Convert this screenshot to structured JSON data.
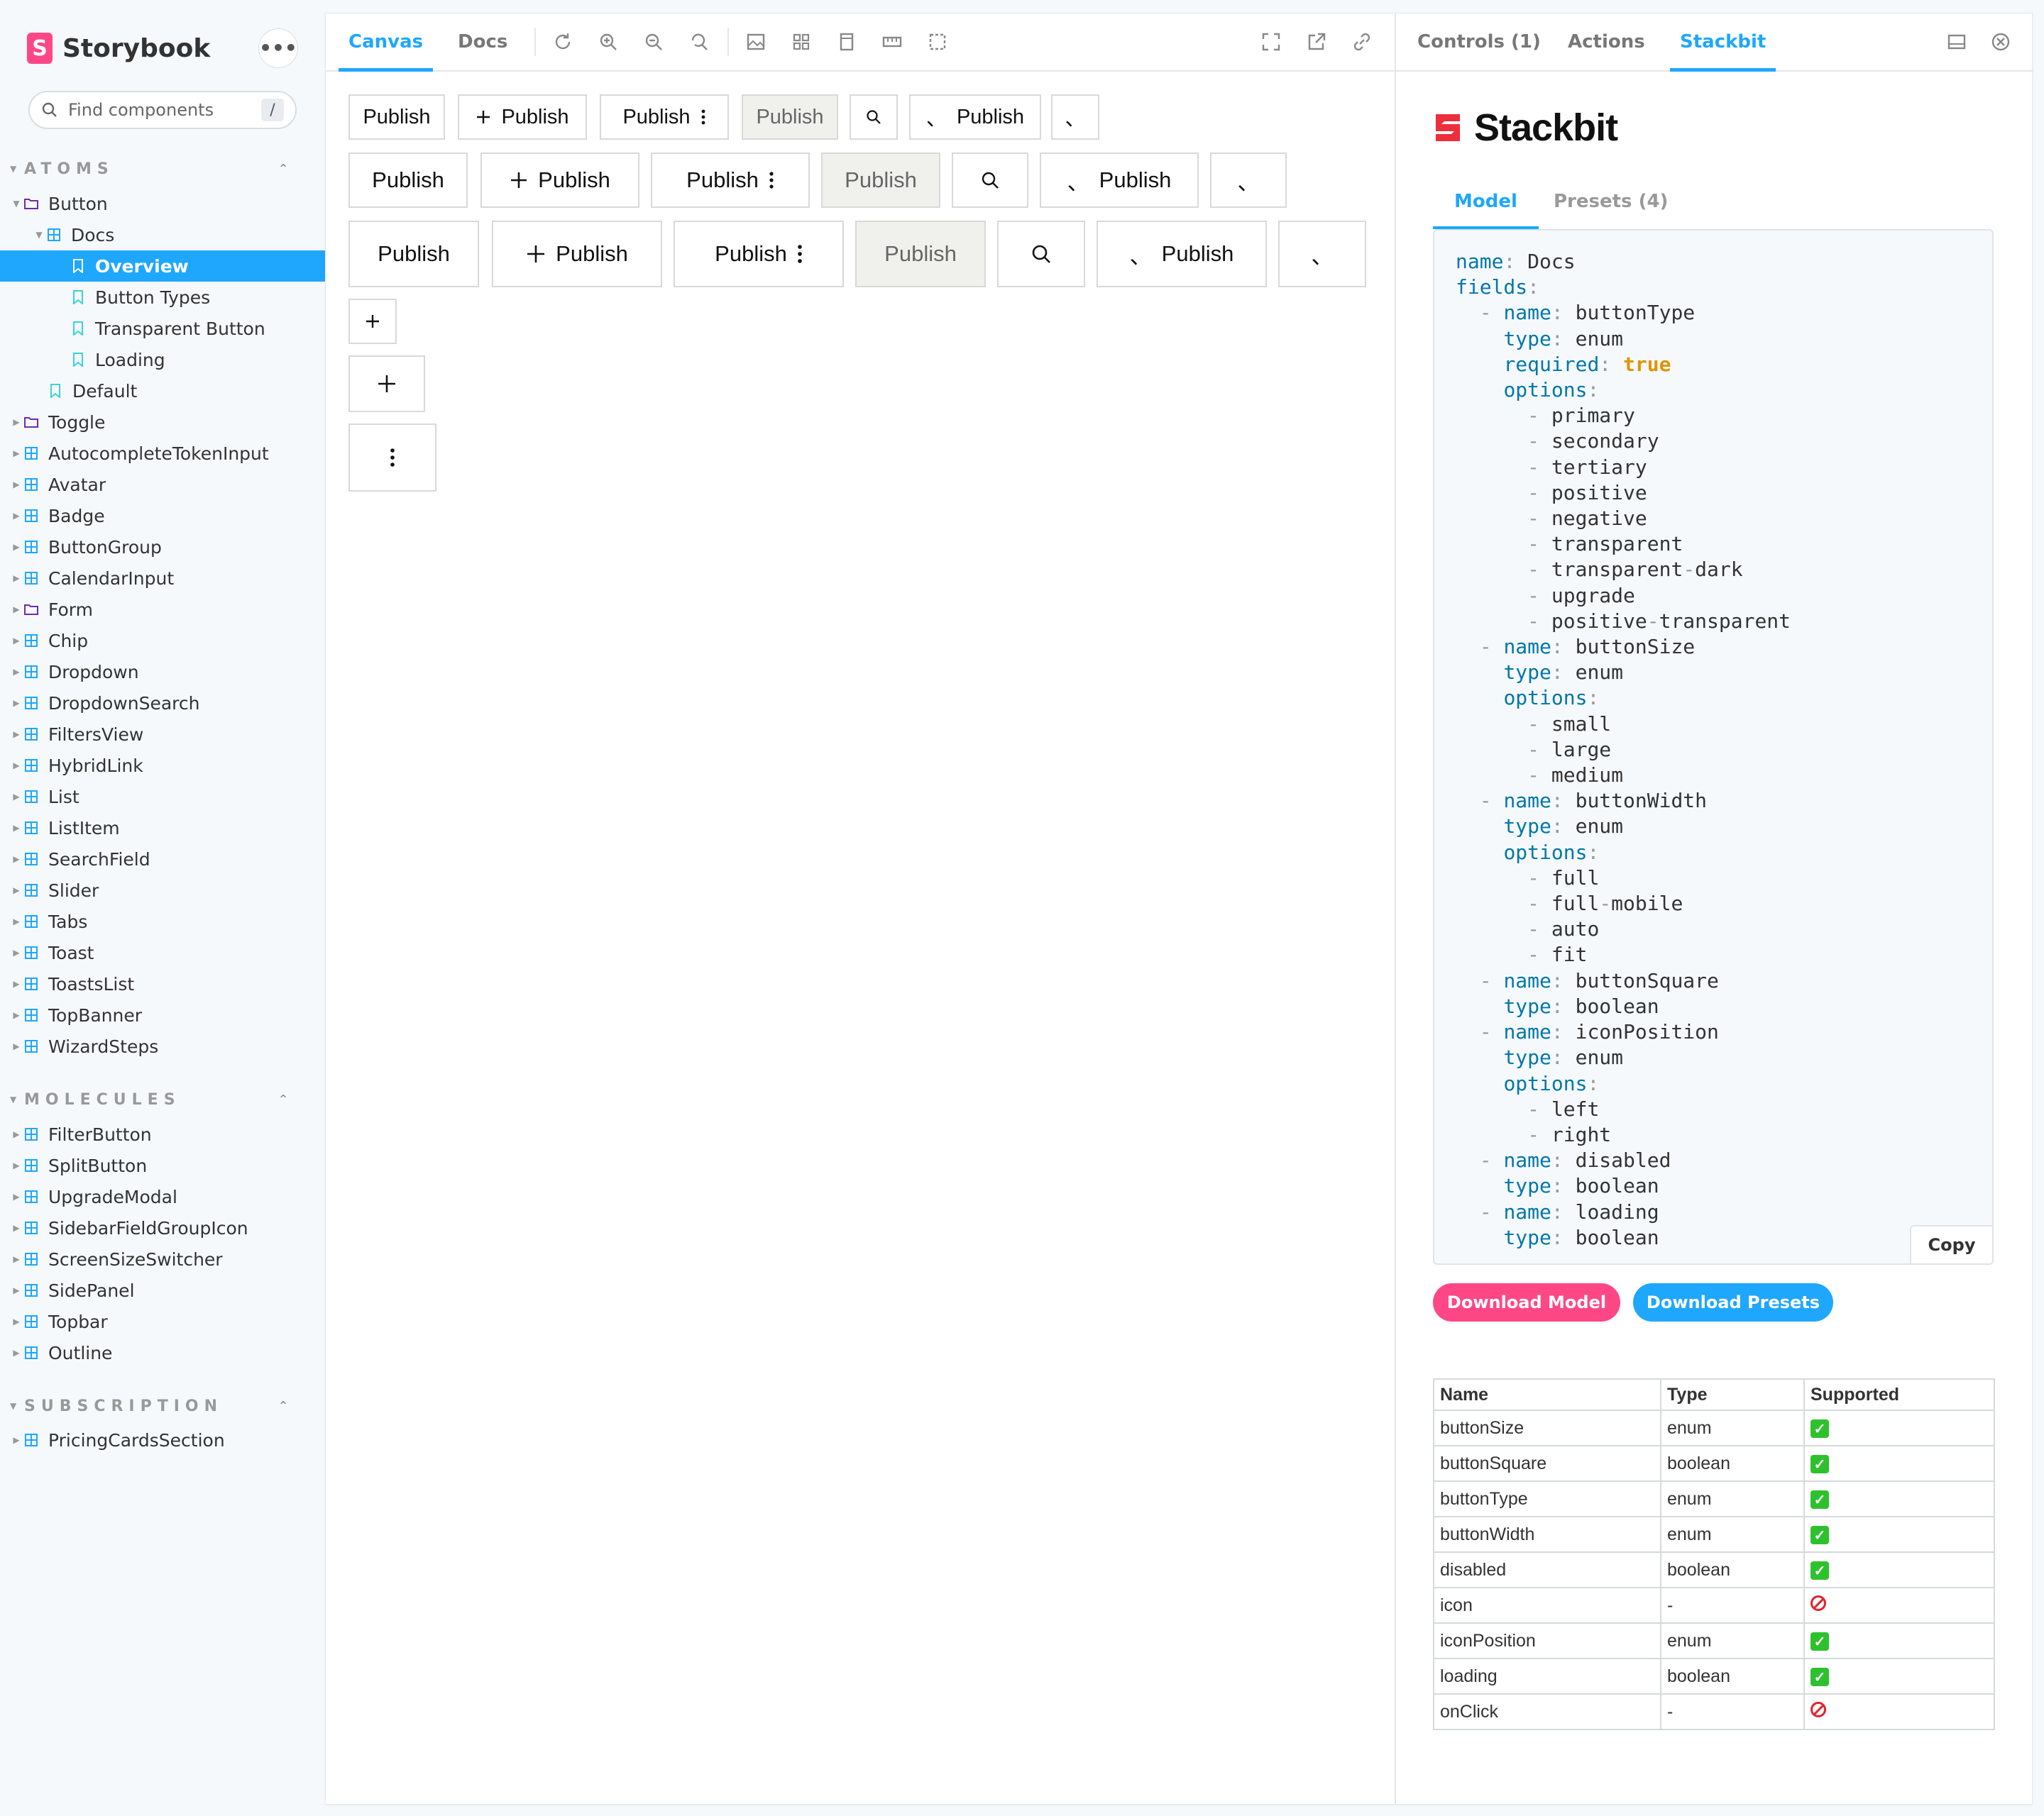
{
  "sidebar": {
    "brand": "Storybook",
    "search_placeholder": "Find components",
    "search_shortcut": "/",
    "sections": [
      {
        "title": "ATOMS"
      },
      {
        "title": "MOLECULES"
      },
      {
        "title": "SUBSCRIPTION"
      }
    ],
    "atoms": {
      "button": "Button",
      "docs": "Docs",
      "overview": "Overview",
      "button_types": "Button Types",
      "transparent_button": "Transparent Button",
      "loading": "Loading",
      "default": "Default",
      "items": [
        "Toggle",
        "AutocompleteTokenInput",
        "Avatar",
        "Badge",
        "ButtonGroup",
        "CalendarInput",
        "Form",
        "Chip",
        "Dropdown",
        "DropdownSearch",
        "FiltersView",
        "HybridLink",
        "List",
        "ListItem",
        "SearchField",
        "Slider",
        "Tabs",
        "Toast",
        "ToastsList",
        "TopBanner",
        "WizardSteps"
      ]
    },
    "molecules": [
      "FilterButton",
      "SplitButton",
      "UpgradeModal",
      "SidebarFieldGroupIcon",
      "ScreenSizeSwitcher",
      "SidePanel",
      "Topbar",
      "Outline"
    ],
    "subscription": [
      "PricingCardsSection"
    ]
  },
  "toolbar": {
    "tabs": [
      "Canvas",
      "Docs"
    ],
    "active_tab": "Canvas",
    "icons": [
      "refresh-icon",
      "zoom-in-icon",
      "zoom-out-icon",
      "zoom-reset-icon",
      "background-icon",
      "grid-icon",
      "viewport-icon",
      "measure-icon",
      "outline-icon",
      "fullscreen-icon",
      "open-new-tab-icon",
      "copy-link-icon"
    ]
  },
  "canvas": {
    "button_label": "Publish"
  },
  "addon": {
    "tabs": [
      "Controls (1)",
      "Actions",
      "Stackbit"
    ],
    "active_tab": "Stackbit",
    "brand": "Stackbit",
    "subtabs": [
      "Model",
      "Presets (4)"
    ],
    "active_subtab": "Model",
    "copy_label": "Copy",
    "download_model": "Download Model",
    "download_presets": "Download Presets",
    "model_name": "Docs",
    "table": {
      "headers": [
        "Name",
        "Type",
        "Supported"
      ],
      "rows": [
        {
          "name": "buttonSize",
          "type": "enum",
          "supported": true
        },
        {
          "name": "buttonSquare",
          "type": "boolean",
          "supported": true
        },
        {
          "name": "buttonType",
          "type": "enum",
          "supported": true
        },
        {
          "name": "buttonWidth",
          "type": "enum",
          "supported": true
        },
        {
          "name": "disabled",
          "type": "boolean",
          "supported": true
        },
        {
          "name": "icon",
          "type": "-",
          "supported": false
        },
        {
          "name": "iconPosition",
          "type": "enum",
          "supported": true
        },
        {
          "name": "loading",
          "type": "boolean",
          "supported": true
        },
        {
          "name": "onClick",
          "type": "-",
          "supported": false
        }
      ]
    }
  },
  "colors": {
    "accent": "#1ea7fd",
    "storybook_pink": "#ff4785",
    "download_model_bg": "#ff4785",
    "download_presets_bg": "#1ea7fd",
    "supported_green": "#2ec12e",
    "unsupported_red": "#e0242c"
  }
}
